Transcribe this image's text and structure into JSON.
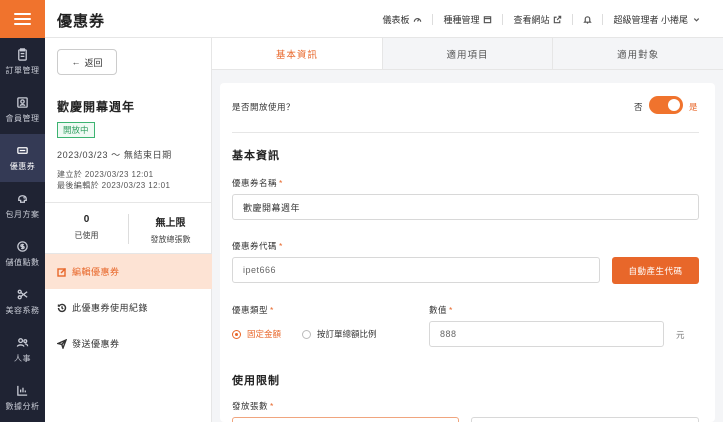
{
  "header": {
    "title": "優惠券",
    "links": [
      {
        "label": "儀表板",
        "icon": "dashboard-icon"
      },
      {
        "label": "種種管理",
        "icon": "calendar-icon"
      },
      {
        "label": "查看網站",
        "icon": "external-link-icon"
      }
    ],
    "user": "超級管理者 小捲尾"
  },
  "sidebar": {
    "items": [
      {
        "label": "訂單管理",
        "icon": "clipboard-icon"
      },
      {
        "label": "會員管理",
        "icon": "id-card-icon"
      },
      {
        "label": "優惠券",
        "icon": "ticket-icon",
        "active": true
      },
      {
        "label": "包月方案",
        "icon": "piggy-bank-icon"
      },
      {
        "label": "儲值點數",
        "icon": "dollar-icon"
      },
      {
        "label": "美容系務",
        "icon": "scissors-icon"
      },
      {
        "label": "人事",
        "icon": "people-icon"
      },
      {
        "label": "數據分析",
        "icon": "chart-icon"
      }
    ]
  },
  "info": {
    "back_label": "返回",
    "coupon_name": "歡慶開幕週年",
    "status": "開放中",
    "date_range": "2023/03/23 ～ 無結束日期",
    "created": "建立於 2023/03/23 12:01",
    "edited": "最後編輯於 2023/03/23 12:01",
    "stats": {
      "used_value": "0",
      "used_label": "已使用",
      "total_value": "無上限",
      "total_label": "發放總張數"
    },
    "actions": [
      {
        "label": "編輯優惠券",
        "icon": "edit-icon",
        "active": true
      },
      {
        "label": "此優惠券使用紀錄",
        "icon": "history-icon"
      },
      {
        "label": "發送優惠券",
        "icon": "send-icon"
      }
    ]
  },
  "tabs": [
    {
      "label": "基本資訊",
      "active": true
    },
    {
      "label": "適用項目"
    },
    {
      "label": "適用對象"
    }
  ],
  "form": {
    "open_question": "是否開放使用？",
    "toggle_off": "否",
    "toggle_on": "是",
    "toggle_state": true,
    "basic_section": "基本資訊",
    "name_label": "優惠券名稱",
    "name_value": "歡慶開幕週年",
    "code_label": "優惠券代碼",
    "code_value": "ipet666",
    "auto_code_button": "自動產生代碼",
    "type_label": "優惠類型",
    "type_options": [
      "固定金額",
      "按訂單總額比例"
    ],
    "type_selected": "固定金額",
    "amount_label": "數值",
    "amount_value": "888",
    "amount_unit": "元",
    "limit_section": "使用限制",
    "issue_label": "發放張數",
    "accent_color": "#e8672a"
  }
}
